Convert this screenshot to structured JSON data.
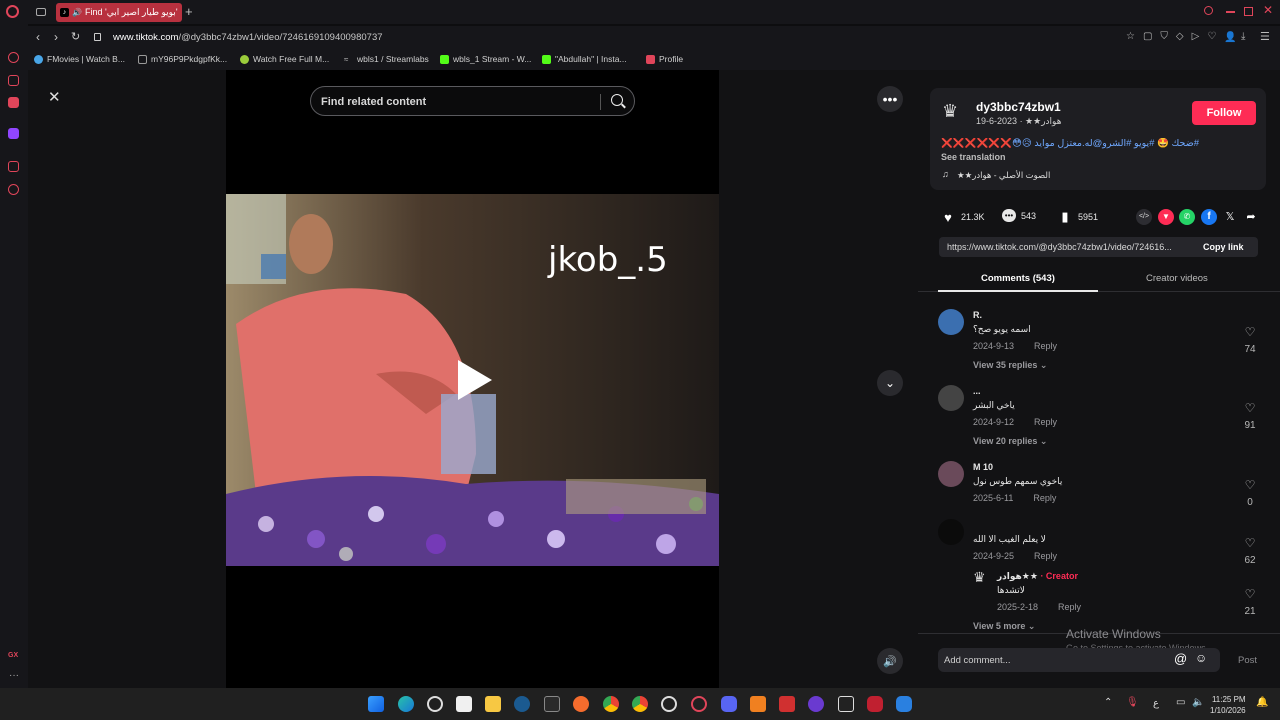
{
  "browser": {
    "tab_title": "Find 'بويو طيار اصير ابي'",
    "url_host": "www.tiktok.com",
    "url_path": "/@dy3bbc74zbw1/video/7246169109400980737",
    "bookmarks": [
      {
        "label": "FMovies | Watch B...",
        "color": "#49a6e8"
      },
      {
        "label": "mY96P9PkdgpfKk...",
        "color": "#9a9a9a"
      },
      {
        "label": "Watch Free Full M...",
        "color": "#9bcc3b"
      },
      {
        "label": "wbls1 / Streamlabs",
        "color": "#c0c0c0"
      },
      {
        "label": "wbls_1 Stream - W...",
        "color": "#53fc18"
      },
      {
        "label": "\"Abdullah\" | Insta...",
        "color": "#53fc18"
      },
      {
        "label": "Profile",
        "color": "#e0455a"
      }
    ],
    "sidebar_bottom_label": "GX"
  },
  "video": {
    "search_placeholder": "Find related content",
    "overlay_text": "jkob_.5"
  },
  "post": {
    "username": "dy3bbc74zbw1",
    "subtitle": "هوادر★★ · 2023-6-19",
    "follow_label": "Follow",
    "caption": "#ضحك 🤩 #يويو #الشرو@له.معتزل موايد 😥😳❌❌❌❌❌❌",
    "see_translation": "See translation",
    "sound": "الصوت الأصلي - هوادر★★",
    "likes": "21.3K",
    "comments": "543",
    "saves": "5951",
    "link": "https://www.tiktok.com/@dy3bbc74zbw1/video/724616...",
    "copy_link": "Copy link",
    "tab_comments": "Comments (543)",
    "tab_creator": "Creator videos"
  },
  "comments": [
    {
      "name": "R.",
      "text": "اسمه يويو صح؟",
      "date": "2024-9-13",
      "reply": "Reply",
      "likes": "74",
      "replies": "View 35 replies",
      "avatar_color": "#3b6fb0"
    },
    {
      "name": "...",
      "text": "ياخي البشر",
      "date": "2024-9-12",
      "reply": "Reply",
      "likes": "91",
      "replies": "View 20 replies",
      "avatar_color": "#444444"
    },
    {
      "name": "M 10",
      "text": "ياخوي سمهم طوس نول",
      "date": "2025-6-11",
      "reply": "Reply",
      "likes": "0",
      "replies": "",
      "avatar_color": "#6a4a5a"
    },
    {
      "name": "",
      "text": "لا يعلم الغيب الا الله",
      "date": "2024-9-25",
      "reply": "Reply",
      "likes": "62",
      "replies": "View 5 more",
      "avatar_color": "#0b0b0b"
    }
  ],
  "creator_reply": {
    "name": "هوادر★★",
    "creator_tag": "· Creator",
    "text": "لاتشدها",
    "date": "2025-2-18",
    "reply": "Reply",
    "likes": "21"
  },
  "add_comment": {
    "placeholder": "Add comment...",
    "post_label": "Post"
  },
  "watermark": {
    "line1": "Activate Windows",
    "line2": "Go to Settings to activate Windows."
  },
  "taskbar": {
    "time": "11:25 PM",
    "date": "1/10/2026",
    "lang": "ع"
  },
  "colors": {
    "accent": "#fe2c55",
    "opera_red": "#e0455a"
  }
}
